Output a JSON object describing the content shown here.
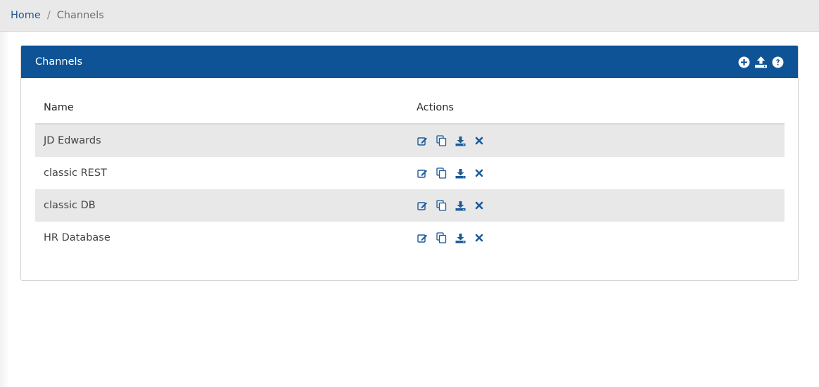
{
  "breadcrumb": {
    "home": "Home",
    "separator": "/",
    "current": "Channels"
  },
  "card": {
    "title": "Channels",
    "header_icons": [
      "add-circle-icon",
      "upload-icon",
      "help-icon"
    ]
  },
  "table": {
    "columns": [
      "Name",
      "Actions"
    ],
    "rows": [
      {
        "name": "JD Edwards"
      },
      {
        "name": "classic REST"
      },
      {
        "name": "classic DB"
      },
      {
        "name": "HR Database"
      }
    ],
    "row_actions": [
      "edit-icon",
      "copy-icon",
      "download-icon",
      "delete-icon"
    ]
  },
  "colors": {
    "accent": "#0e5396",
    "link": "#1f5a96",
    "row_alt": "#e8e8e8"
  }
}
